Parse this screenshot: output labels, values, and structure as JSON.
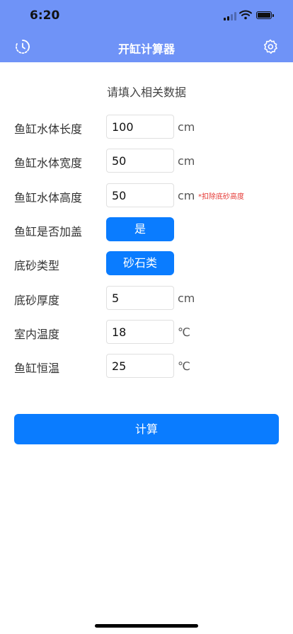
{
  "status_bar": {
    "time": "6:20"
  },
  "navbar": {
    "title": "开缸计算器",
    "left_icon": "history-icon",
    "right_icon": "settings-icon"
  },
  "form": {
    "title": "请填入相关数据",
    "length": {
      "label": "鱼缸水体长度",
      "value": "100",
      "unit": "cm"
    },
    "width": {
      "label": "鱼缸水体宽度",
      "value": "50",
      "unit": "cm"
    },
    "height": {
      "label": "鱼缸水体高度",
      "value": "50",
      "unit": "cm",
      "note": "*扣除底砂高度"
    },
    "lid": {
      "label": "鱼缸是否加盖",
      "value": "是"
    },
    "substrate_type": {
      "label": "底砂类型",
      "value": "砂石类"
    },
    "substrate_thickness": {
      "label": "底砂厚度",
      "value": "5",
      "unit": "cm"
    },
    "room_temp": {
      "label": "室内温度",
      "value": "18",
      "unit": "℃"
    },
    "tank_temp": {
      "label": "鱼缸恒温",
      "value": "25",
      "unit": "℃"
    }
  },
  "actions": {
    "calculate": "计算"
  },
  "colors": {
    "navbar": "#6f93f7",
    "primary": "#0a7cff",
    "note": "#e53935"
  }
}
